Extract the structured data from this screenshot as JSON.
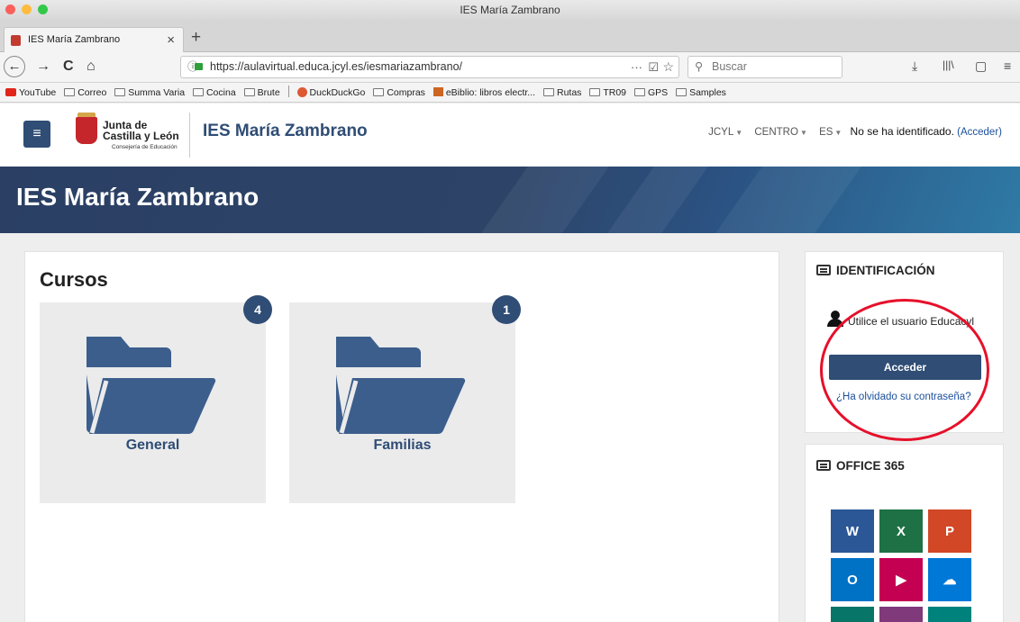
{
  "window": {
    "title": "IES María Zambrano"
  },
  "tab": {
    "label": "IES María Zambrano",
    "close": "×",
    "new_tab": "+"
  },
  "nav": {
    "back": "←",
    "forward": "→",
    "reload": "C",
    "home": "⌂",
    "url": "https://aulavirtual.educa.jcyl.es/iesmariazambrano/",
    "page_actions": "···",
    "pocket": "☑",
    "star": "☆",
    "search_placeholder": "Buscar",
    "download": "⤓",
    "library": "|||\\",
    "sidebar": "▢",
    "menu": "≡"
  },
  "bookmarks": [
    {
      "label": "YouTube",
      "icon": "youtube-icon"
    },
    {
      "label": "Correo",
      "icon": "folder-icon"
    },
    {
      "label": "Summa Varia",
      "icon": "folder-icon"
    },
    {
      "label": "Cocina",
      "icon": "folder-icon"
    },
    {
      "label": "Brute",
      "icon": "folder-icon"
    },
    {
      "label": "DuckDuckGo",
      "icon": "duckduckgo-icon"
    },
    {
      "label": "Compras",
      "icon": "folder-icon"
    },
    {
      "label": "eBiblio: libros electr...",
      "icon": "ebiblio-icon"
    },
    {
      "label": "Rutas",
      "icon": "folder-icon"
    },
    {
      "label": "TR09",
      "icon": "folder-icon"
    },
    {
      "label": "GPS",
      "icon": "folder-icon"
    },
    {
      "label": "Samples",
      "icon": "folder-icon"
    }
  ],
  "site": {
    "hamburger": "≡",
    "logo_line1": "Junta de",
    "logo_line2": "Castilla y León",
    "logo_line3": "Consejería de Educación",
    "name": "IES María Zambrano",
    "menu": [
      "JCYL",
      "CENTRO",
      "ES"
    ],
    "login_text": "No se ha identificado.",
    "login_link": "(Acceder)"
  },
  "hero": {
    "title": "IES María Zambrano"
  },
  "courses": {
    "heading": "Cursos",
    "items": [
      {
        "title": "General",
        "count": "4"
      },
      {
        "title": "Familias",
        "count": "1"
      }
    ]
  },
  "identificacion": {
    "heading": "IDENTIFICACIÓN",
    "hint": "Utilice el usuario Educacyl",
    "button": "Acceder",
    "forgot": "¿Ha olvidado su contraseña?"
  },
  "office": {
    "heading": "OFFICE 365",
    "tiles": [
      {
        "label": "W",
        "icon": "word-icon",
        "color": "#2b5797"
      },
      {
        "label": "X",
        "icon": "excel-icon",
        "color": "#1e7145"
      },
      {
        "label": "P",
        "icon": "powerpoint-icon",
        "color": "#d24726"
      },
      {
        "label": "O",
        "icon": "outlook-icon",
        "color": "#0072c6"
      },
      {
        "label": "▶",
        "icon": "stream-icon",
        "color": "#c30052"
      },
      {
        "label": "☁",
        "icon": "onedrive-icon",
        "color": "#0078d7"
      }
    ]
  },
  "colors": {
    "brand": "#2f4d75",
    "link": "#1b4f9c",
    "highlight_circle": "#e6102a"
  }
}
